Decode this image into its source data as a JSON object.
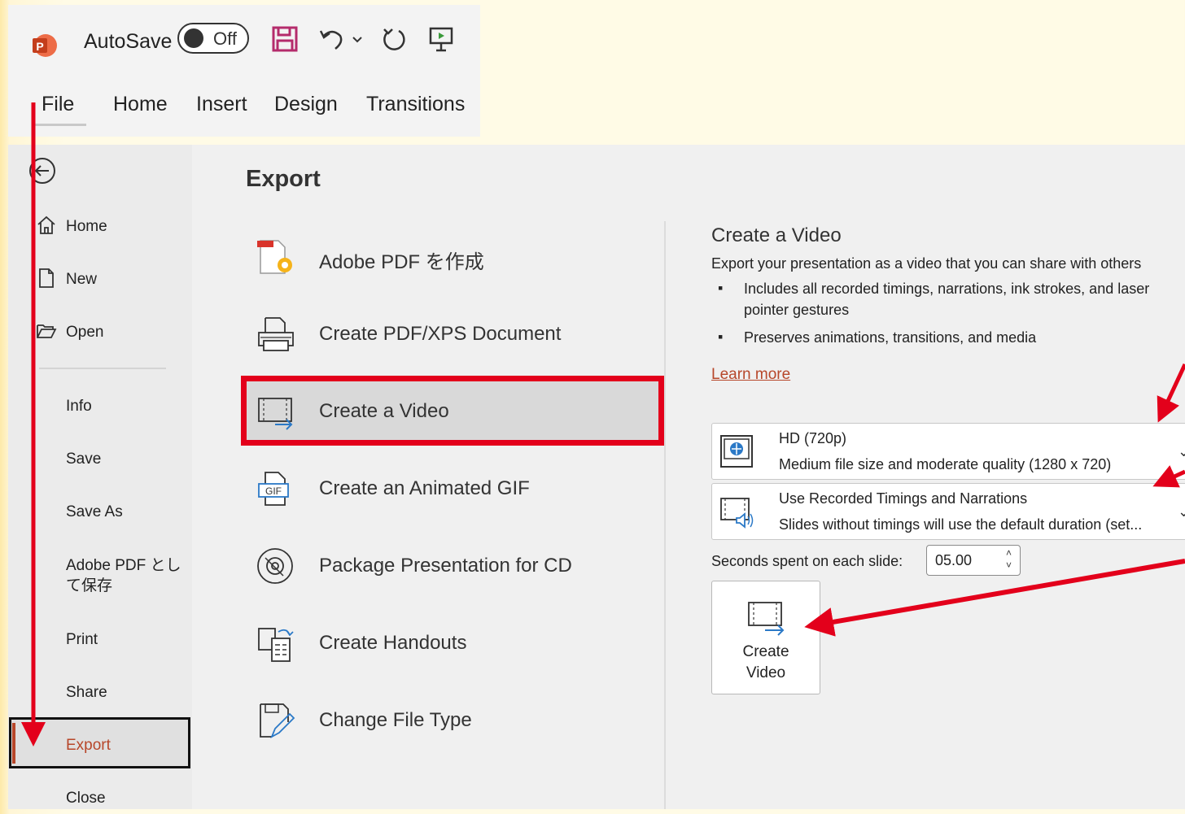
{
  "qat": {
    "autosave_label": "AutoSave",
    "autosave_state": "Off"
  },
  "ribbon_tabs": [
    "File",
    "Home",
    "Insert",
    "Design",
    "Transitions"
  ],
  "nav": {
    "items": [
      "Home",
      "New",
      "Open",
      "Info",
      "Save",
      "Save As",
      "Adobe PDF とし\nて保存",
      "Print",
      "Share",
      "Export",
      "Close"
    ],
    "selected": "Export"
  },
  "export": {
    "title": "Export",
    "options": [
      "Adobe PDF を作成",
      "Create PDF/XPS Document",
      "Create a Video",
      "Create an Animated GIF",
      "Package Presentation for CD",
      "Create Handouts",
      "Change File Type"
    ],
    "selected": "Create a Video"
  },
  "video": {
    "title": "Create a Video",
    "description": "Export your presentation as a video that you can share with others",
    "bullets": [
      "Includes all recorded timings, narrations, ink strokes, and laser pointer gestures",
      "Preserves animations, transitions, and media"
    ],
    "learn_more": "Learn more",
    "quality": {
      "title": "HD (720p)",
      "subtitle": "Medium file size and moderate quality (1280 x 720)"
    },
    "timings": {
      "title": "Use Recorded Timings and Narrations",
      "subtitle": "Slides without timings will use the default duration (set..."
    },
    "seconds_label": "Seconds spent on each slide:",
    "seconds_value": "05.00",
    "create_button": "Create\nVideo"
  },
  "colors": {
    "accent": "#b7472a",
    "annotation_red": "#e3001b"
  }
}
